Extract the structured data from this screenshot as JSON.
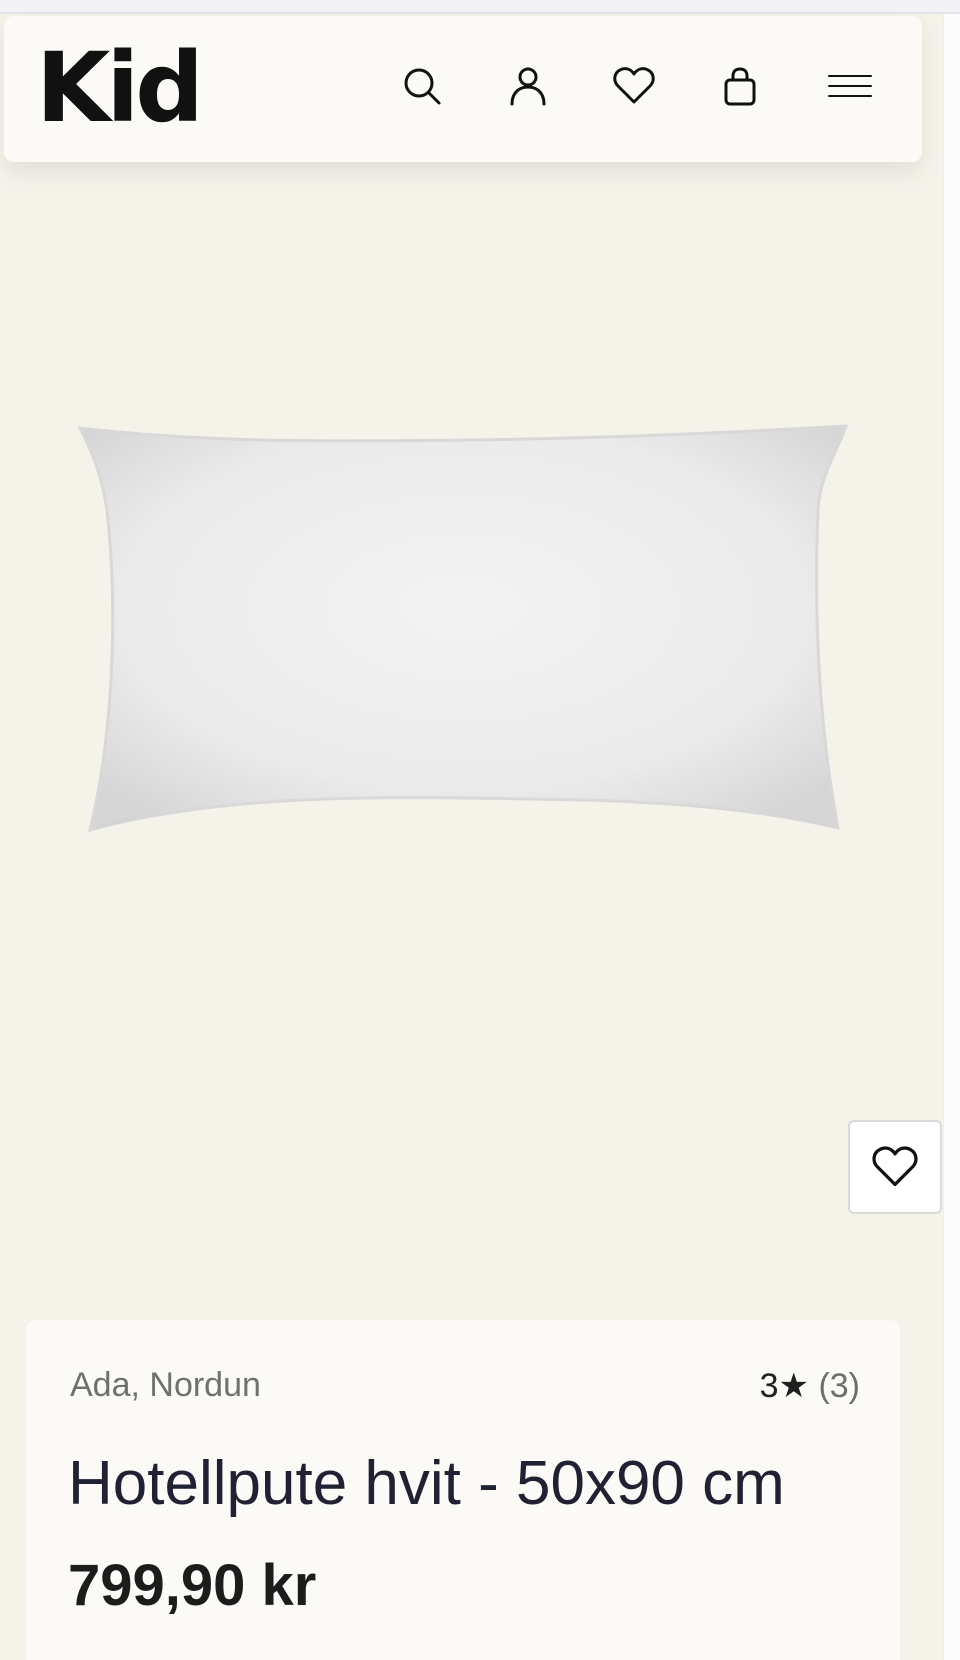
{
  "header": {
    "logo_text": "Kid",
    "icons": {
      "search": "search-icon",
      "account": "user-icon",
      "wishlist": "heart-icon",
      "cart": "shopping-bag-icon",
      "menu": "hamburger-menu-icon"
    }
  },
  "product": {
    "image": "white-pillow-product-image",
    "brand": "Ada, Nordun",
    "rating_value": "3",
    "rating_star": "★",
    "rating_count": "(3)",
    "title": "Hotellpute hvit - 50x90 cm",
    "price": "799,90 kr",
    "wishlist_icon": "heart-icon"
  },
  "colors": {
    "page_background": "#f5f2ea",
    "card_background": "#fbfaf6",
    "text_dark": "#1c1c1c",
    "text_muted": "#707070"
  }
}
